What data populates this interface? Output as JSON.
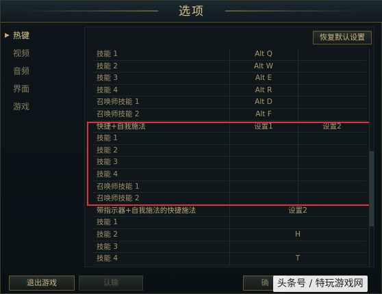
{
  "window": {
    "title": "选项"
  },
  "sidebar": {
    "items": [
      {
        "label": "热键",
        "active": true
      },
      {
        "label": "视频"
      },
      {
        "label": "音频"
      },
      {
        "label": "界面"
      },
      {
        "label": "游戏"
      }
    ]
  },
  "toolbar": {
    "restore_label": "恢复默认设置"
  },
  "top_rows": [
    {
      "name": "技能 1",
      "key1": "Alt  Q",
      "key2": ""
    },
    {
      "name": "技能 2",
      "key1": "Alt  W",
      "key2": ""
    },
    {
      "name": "技能 3",
      "key1": "Alt  E",
      "key2": ""
    },
    {
      "name": "技能 4",
      "key1": "Alt  R",
      "key2": ""
    },
    {
      "name": "召唤师技能 1",
      "key1": "Alt  D",
      "key2": ""
    },
    {
      "name": "召唤师技能 2",
      "key1": "Alt  F",
      "key2": ""
    }
  ],
  "section_self": {
    "header": {
      "name": "快捷+自我施法",
      "key1": "设置1",
      "key2": "设置2"
    },
    "rows": [
      {
        "name": "技能 1",
        "key1": "",
        "key2": ""
      },
      {
        "name": "技能 2",
        "key1": "",
        "key2": ""
      },
      {
        "name": "技能 3",
        "key1": "",
        "key2": ""
      },
      {
        "name": "技能 4",
        "key1": "",
        "key2": ""
      },
      {
        "name": "召唤师技能 1",
        "key1": "",
        "key2": ""
      },
      {
        "name": "召唤师技能 2",
        "key1": "",
        "key2": ""
      }
    ]
  },
  "section_indicator": {
    "header": {
      "name": "带指示器+自我施法的快捷施法",
      "setting": "设置2"
    },
    "rows": [
      {
        "name": "技能 1",
        "key": ""
      },
      {
        "name": "技能 2",
        "key": "H"
      },
      {
        "name": "技能 3",
        "key": ""
      },
      {
        "name": "技能 4",
        "key": "T"
      }
    ]
  },
  "footer": {
    "exit_label": "退出游戏",
    "confirm_label": "认输",
    "ok_label": "确"
  },
  "watermark": {
    "text": "头条号 / 特玩游戏网"
  }
}
